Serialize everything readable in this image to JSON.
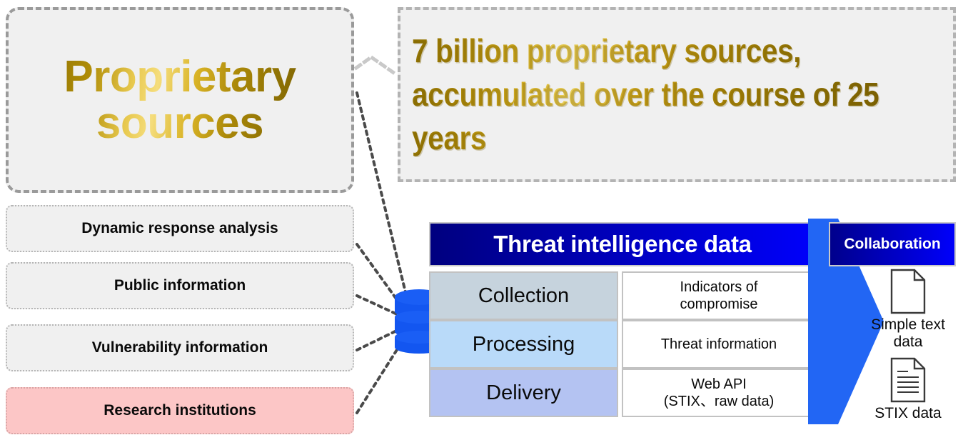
{
  "hero": {
    "title": "Proprietary\nsources",
    "title_line1": "Proprietary",
    "title_line2": "sources"
  },
  "callout": {
    "text": "7 billion proprietary sources, accumulated over the course of 25 years"
  },
  "sources": {
    "items": [
      {
        "label": "Dynamic response analysis",
        "highlight": false
      },
      {
        "label": "Public information",
        "highlight": false
      },
      {
        "label": "Vulnerability information",
        "highlight": false
      },
      {
        "label": "Research institutions",
        "highlight": true
      }
    ]
  },
  "database": {
    "icon": "database-cylinder-icon"
  },
  "table": {
    "header": "Threat intelligence data",
    "rows": [
      {
        "stage": "Collection",
        "detail": "Indicators of\ncompromise",
        "detail_line1": "Indicators of",
        "detail_line2": "compromise",
        "color": "#c6d3dd"
      },
      {
        "stage": "Processing",
        "detail": "Threat information",
        "detail_line1": "Threat information",
        "detail_line2": "",
        "color": "#b9daf9"
      },
      {
        "stage": "Delivery",
        "detail": "Web API\n(STIX、raw data)",
        "detail_line1": "Web API",
        "detail_line2": "(STIX、raw data)",
        "color": "#b4c3f2"
      }
    ]
  },
  "collaboration": {
    "badge": "Collaboration",
    "arrow_color": "#2266f4",
    "outputs": [
      {
        "label": "Simple text\ndata",
        "label_line1": "Simple text",
        "label_line2": "data",
        "icon": "blank-document-icon"
      },
      {
        "label": "STIX data",
        "label_line1": "STIX data",
        "label_line2": "",
        "icon": "lined-document-icon"
      }
    ]
  },
  "colors": {
    "gold_dark": "#8f7204",
    "gold_light": "#f0d66e",
    "header_blue_dark": "#00007f",
    "header_blue_light": "#0000fb",
    "pink": "#fcc6c6",
    "gray_fill": "#f0f0f0"
  }
}
